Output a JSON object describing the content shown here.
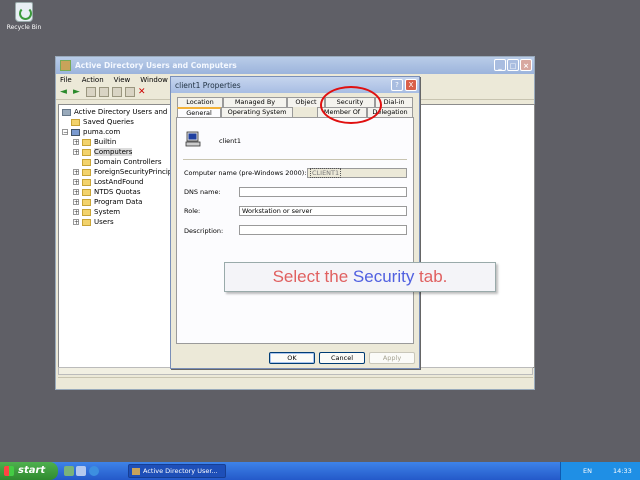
{
  "desktop": {
    "recycle_label": "Recycle Bin"
  },
  "main_window": {
    "title": "Active Directory Users and Computers",
    "menu": [
      "File",
      "Action",
      "View",
      "Window"
    ],
    "tree": {
      "root": "Active Directory Users and Comp",
      "domain": "puma.com",
      "items": [
        "Saved Queries",
        "Builtin",
        "Computers",
        "Domain Controllers",
        "ForeignSecurityPrincipals",
        "LostAndFound",
        "NTDS Quotas",
        "Program Data",
        "System",
        "Users"
      ]
    }
  },
  "dialog": {
    "title": "client1 Properties",
    "help": "?",
    "close": "X",
    "tabs_row1": [
      "Location",
      "Managed By",
      "Object",
      "Security",
      "Dial-in"
    ],
    "tabs_row2": [
      "General",
      "Operating System",
      "Member Of",
      "Delegation"
    ],
    "computer_name_display": "client1",
    "fields": {
      "prewin_label": "Computer name (pre-Windows 2000):",
      "prewin_value": "CLIENT1",
      "dns_label": "DNS name:",
      "dns_value": "",
      "role_label": "Role:",
      "role_value": "Workstation or server",
      "desc_label": "Description:",
      "desc_value": ""
    },
    "buttons": {
      "ok": "OK",
      "cancel": "Cancel",
      "apply": "Apply"
    }
  },
  "callout": {
    "pre": "Select the ",
    "highlight": "Security",
    "post": " tab."
  },
  "taskbar": {
    "start": "start",
    "task": "Active Directory User...",
    "lang": "EN",
    "clock": "14:33"
  }
}
